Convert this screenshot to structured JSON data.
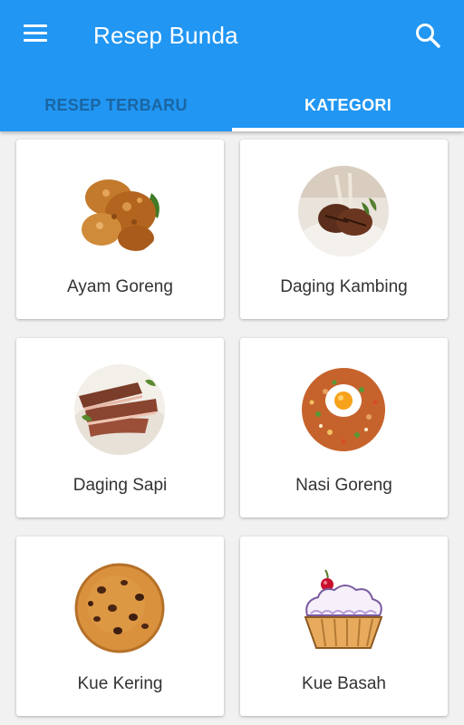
{
  "app": {
    "title": "Resep Bunda"
  },
  "icons": {
    "menu": "menu-icon",
    "search": "search-icon"
  },
  "tabs": [
    {
      "label": "RESEP TERBARU",
      "active": false
    },
    {
      "label": "KATEGORI",
      "active": true
    }
  ],
  "categories": [
    {
      "label": "Ayam Goreng",
      "image": "fried-chicken"
    },
    {
      "label": "Daging Kambing",
      "image": "lamb-chops"
    },
    {
      "label": "Daging Sapi",
      "image": "sliced-beef"
    },
    {
      "label": "Nasi Goreng",
      "image": "fried-rice"
    },
    {
      "label": "Kue Kering",
      "image": "cookie"
    },
    {
      "label": "Kue Basah",
      "image": "cupcake"
    }
  ],
  "colors": {
    "primary": "#2196F3",
    "background": "#f1f1f1",
    "card": "#ffffff",
    "text": "#333333"
  }
}
